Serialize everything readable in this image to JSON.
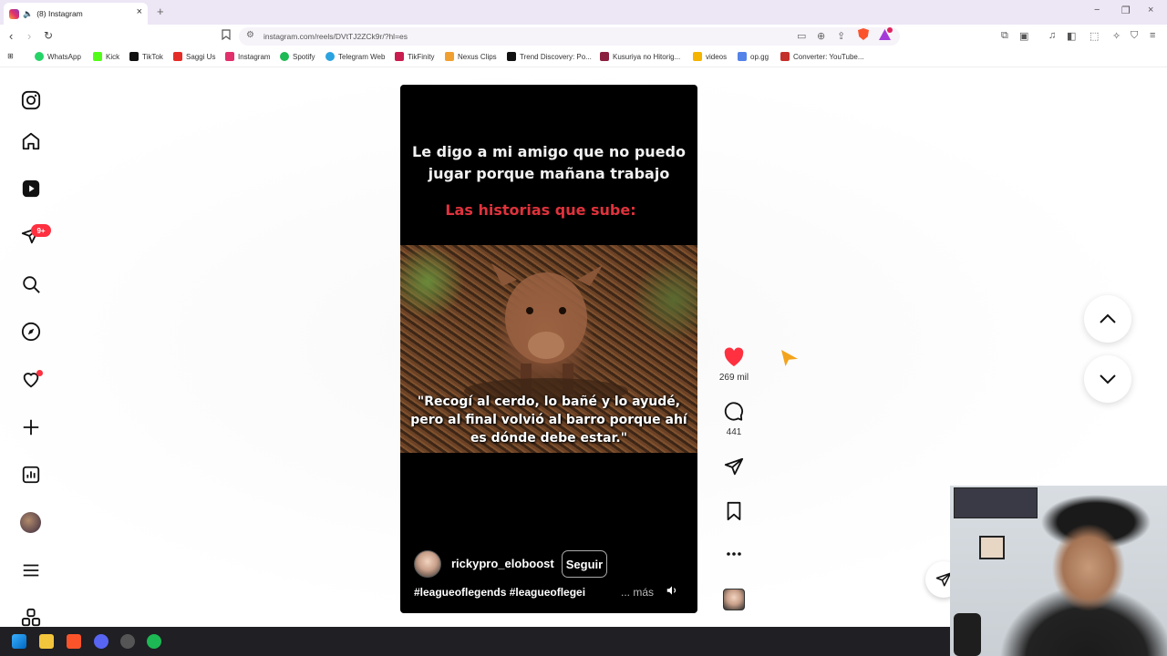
{
  "browser": {
    "tab_title": "(8) Instagram",
    "tab_close": "×",
    "new_tab": "+",
    "url": "instagram.com/reels/DVtTJ2ZCk9r/?hl=es",
    "window_controls": [
      "−",
      "❐",
      "×"
    ]
  },
  "bookmarks": [
    {
      "label": "WhatsApp",
      "color": "#25d366"
    },
    {
      "label": "Kick",
      "color": "#53fc18"
    },
    {
      "label": "TikTok",
      "color": "#111111"
    },
    {
      "label": "Saggi Us",
      "color": "#e52d27"
    },
    {
      "label": "Instagram",
      "color": "#e1306c"
    },
    {
      "label": "Spotify",
      "color": "#1db954"
    },
    {
      "label": "Telegram Web",
      "color": "#2aa3df"
    },
    {
      "label": "TikFinity",
      "color": "#c81d4e"
    },
    {
      "label": "Nexus Clips",
      "color": "#f0a030"
    },
    {
      "label": "Trend Discovery: Po...",
      "color": "#111111"
    },
    {
      "label": "Kusuriya no Hitorig...",
      "color": "#8a2040"
    },
    {
      "label": "videos",
      "color": "#f4b400"
    },
    {
      "label": "op.gg",
      "color": "#5383e8"
    },
    {
      "label": "Converter: YouTube...",
      "color": "#c4302b"
    }
  ],
  "sidebar": {
    "messages_badge": "9+"
  },
  "reel": {
    "caption_top": "Le digo a mi amigo que no puedo jugar porque mañana trabajo",
    "caption_sub": "Las historias que sube:",
    "quote": "\"Recogí al cerdo, lo bañé y lo ayudé, pero al final volvió al barro porque ahí es dónde debe estar.\"",
    "username": "rickypro_eloboost",
    "follow_label": "Seguir",
    "hashtags": "#leagueoflegends #leagueoflegei",
    "more_label": "... más"
  },
  "actions": {
    "likes": "269 mil",
    "comments": "441"
  },
  "colors": {
    "like_red": "#ff3040",
    "caption_red": "#e0323c",
    "accent_badge": "#ff3040"
  }
}
